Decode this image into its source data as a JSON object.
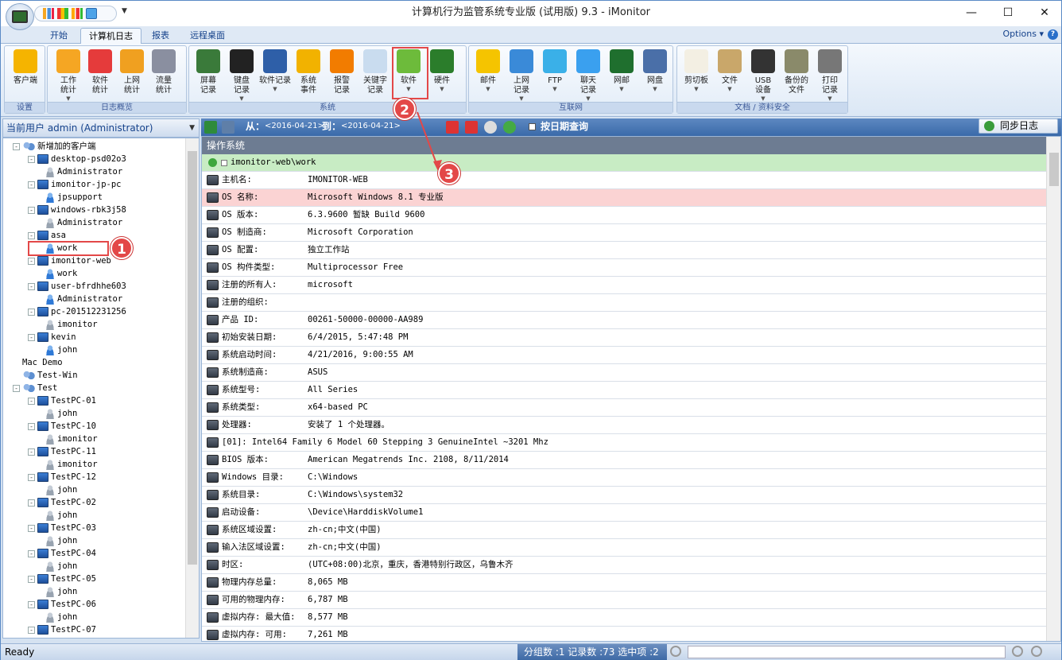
{
  "window": {
    "title": "计算机行为监管系统专业版 (试用版) 9.3 - iMonitor",
    "min_label": "—",
    "max_label": "☐",
    "close_label": "✕"
  },
  "tabs": [
    {
      "label": "开始"
    },
    {
      "label": "计算机日志"
    },
    {
      "label": "报表"
    },
    {
      "label": "远程桌面"
    }
  ],
  "options_label": "Options",
  "ribbon": {
    "groups": [
      {
        "label": "设置",
        "buttons": [
          {
            "l1": "客户端",
            "l2": "",
            "dd": false
          }
        ]
      },
      {
        "label": "日志概览",
        "buttons": [
          {
            "l1": "工作",
            "l2": "统计",
            "dd": true
          },
          {
            "l1": "软件",
            "l2": "统计",
            "dd": false
          },
          {
            "l1": "上网",
            "l2": "统计",
            "dd": false
          },
          {
            "l1": "流量",
            "l2": "统计",
            "dd": false
          }
        ]
      },
      {
        "label": "系统",
        "buttons": [
          {
            "l1": "屏幕",
            "l2": "记录",
            "dd": false
          },
          {
            "l1": "键盘",
            "l2": "记录",
            "dd": true
          },
          {
            "l1": "软件记录",
            "l2": "",
            "dd": true
          },
          {
            "l1": "系统",
            "l2": "事件",
            "dd": false
          },
          {
            "l1": "报警",
            "l2": "记录",
            "dd": false
          },
          {
            "l1": "关键字",
            "l2": "记录",
            "dd": false
          },
          {
            "l1": "软件",
            "l2": "",
            "dd": true
          },
          {
            "l1": "硬件",
            "l2": "",
            "dd": true
          }
        ]
      },
      {
        "label": "互联网",
        "buttons": [
          {
            "l1": "邮件",
            "l2": "",
            "dd": true
          },
          {
            "l1": "上网",
            "l2": "记录",
            "dd": true
          },
          {
            "l1": "FTP",
            "l2": "",
            "dd": true
          },
          {
            "l1": "聊天",
            "l2": "记录",
            "dd": true
          },
          {
            "l1": "网邮",
            "l2": "",
            "dd": true
          },
          {
            "l1": "网盘",
            "l2": "",
            "dd": true
          }
        ]
      },
      {
        "label": "文档 / 资料安全",
        "buttons": [
          {
            "l1": "剪切板",
            "l2": "",
            "dd": true
          },
          {
            "l1": "文件",
            "l2": "",
            "dd": true
          },
          {
            "l1": "USB",
            "l2": "设备",
            "dd": true
          },
          {
            "l1": "备份的",
            "l2": "文件",
            "dd": false
          },
          {
            "l1": "打印",
            "l2": "记录",
            "dd": true
          }
        ]
      }
    ]
  },
  "callouts": [
    "1",
    "2",
    "3"
  ],
  "left_panel": {
    "header": "当前用户 admin (Administrator)",
    "tree": [
      {
        "label": "新增加的客户端",
        "level": 0,
        "type": "group",
        "exp": "-"
      },
      {
        "label": "desktop-psd02o3",
        "level": 1,
        "type": "pc",
        "exp": "-"
      },
      {
        "label": "Administrator",
        "level": 2,
        "type": "user-grey"
      },
      {
        "label": "imonitor-jp-pc",
        "level": 1,
        "type": "pc",
        "exp": "-"
      },
      {
        "label": "jpsupport",
        "level": 2,
        "type": "user"
      },
      {
        "label": "windows-rbk3j58",
        "level": 1,
        "type": "pc",
        "exp": "-"
      },
      {
        "label": "Administrator",
        "level": 2,
        "type": "user-grey"
      },
      {
        "label": "asa",
        "level": 1,
        "type": "pc",
        "exp": "-"
      },
      {
        "label": "work",
        "level": 2,
        "type": "user"
      },
      {
        "label": "imonitor-web",
        "level": 1,
        "type": "pc",
        "exp": "-"
      },
      {
        "label": "work",
        "level": 2,
        "type": "user"
      },
      {
        "label": "user-bfrdhhe603",
        "level": 1,
        "type": "pc",
        "exp": "-"
      },
      {
        "label": "Administrator",
        "level": 2,
        "type": "user"
      },
      {
        "label": "pc-201512231256",
        "level": 1,
        "type": "pc",
        "exp": "-"
      },
      {
        "label": "imonitor",
        "level": 2,
        "type": "user-grey"
      },
      {
        "label": "kevin",
        "level": 1,
        "type": "pc",
        "exp": "-"
      },
      {
        "label": "john",
        "level": 2,
        "type": "user"
      },
      {
        "label": "Mac Demo",
        "level": 0,
        "type": "none"
      },
      {
        "label": "Test-Win",
        "level": 0,
        "type": "group"
      },
      {
        "label": "Test",
        "level": 0,
        "type": "group",
        "exp": "-"
      },
      {
        "label": "TestPC-01",
        "level": 1,
        "type": "pc",
        "exp": "-"
      },
      {
        "label": "john",
        "level": 2,
        "type": "user-grey"
      },
      {
        "label": "TestPC-10",
        "level": 1,
        "type": "pc",
        "exp": "-"
      },
      {
        "label": "imonitor",
        "level": 2,
        "type": "user-grey"
      },
      {
        "label": "TestPC-11",
        "level": 1,
        "type": "pc",
        "exp": "-"
      },
      {
        "label": "imonitor",
        "level": 2,
        "type": "user-grey"
      },
      {
        "label": "TestPC-12",
        "level": 1,
        "type": "pc",
        "exp": "-"
      },
      {
        "label": "john",
        "level": 2,
        "type": "user-grey"
      },
      {
        "label": "TestPC-02",
        "level": 1,
        "type": "pc",
        "exp": "-"
      },
      {
        "label": "john",
        "level": 2,
        "type": "user-grey"
      },
      {
        "label": "TestPC-03",
        "level": 1,
        "type": "pc",
        "exp": "-"
      },
      {
        "label": "john",
        "level": 2,
        "type": "user-grey"
      },
      {
        "label": "TestPC-04",
        "level": 1,
        "type": "pc",
        "exp": "-"
      },
      {
        "label": "john",
        "level": 2,
        "type": "user-grey"
      },
      {
        "label": "TestPC-05",
        "level": 1,
        "type": "pc",
        "exp": "-"
      },
      {
        "label": "john",
        "level": 2,
        "type": "user-grey"
      },
      {
        "label": "TestPC-06",
        "level": 1,
        "type": "pc",
        "exp": "-"
      },
      {
        "label": "john",
        "level": 2,
        "type": "user-grey"
      },
      {
        "label": "TestPC-07",
        "level": 1,
        "type": "pc",
        "exp": "-"
      }
    ]
  },
  "right_panel": {
    "from_label": "从：",
    "from_date": "<2016-04-21>",
    "to_label": "到：",
    "to_date": "<2016-04-21>",
    "by_date_label": "按日期查询",
    "sync_label": "同步日志",
    "grid_header": "操作系统",
    "group_row": "imonitor-web\\work",
    "rows": [
      {
        "k": "主机名:",
        "v": "IMONITOR-WEB"
      },
      {
        "k": "OS 名称:",
        "v": "Microsoft Windows 8.1 专业版",
        "hl": true
      },
      {
        "k": "OS 版本:",
        "v": "6.3.9600 暂缺 Build 9600"
      },
      {
        "k": "OS 制造商:",
        "v": "Microsoft Corporation"
      },
      {
        "k": "OS 配置:",
        "v": "独立工作站"
      },
      {
        "k": "OS 构件类型:",
        "v": "Multiprocessor Free"
      },
      {
        "k": "注册的所有人:",
        "v": "microsoft"
      },
      {
        "k": "注册的组织:",
        "v": ""
      },
      {
        "k": "产品 ID:",
        "v": "00261-50000-00000-AA989"
      },
      {
        "k": "初始安装日期:",
        "v": "6/4/2015, 5:47:48 PM"
      },
      {
        "k": "系统启动时间:",
        "v": "4/21/2016, 9:00:55 AM"
      },
      {
        "k": "系统制造商:",
        "v": "ASUS"
      },
      {
        "k": "系统型号:",
        "v": "All Series"
      },
      {
        "k": "系统类型:",
        "v": "x64-based PC"
      },
      {
        "k": "处理器:",
        "v": "安装了 1 个处理器。"
      },
      {
        "full": "[01]: Intel64 Family 6 Model 60 Stepping 3 GenuineIntel ~3201 Mhz"
      },
      {
        "k": "BIOS 版本:",
        "v": "American Megatrends Inc. 2108, 8/11/2014"
      },
      {
        "k": "Windows 目录:",
        "v": "C:\\Windows"
      },
      {
        "k": "系统目录:",
        "v": "C:\\Windows\\system32"
      },
      {
        "k": "启动设备:",
        "v": "\\Device\\HarddiskVolume1"
      },
      {
        "k": "系统区域设置:",
        "v": "zh-cn;中文(中国)"
      },
      {
        "k": "输入法区域设置:",
        "v": "zh-cn;中文(中国)"
      },
      {
        "k": "时区:",
        "v": "(UTC+08:00)北京，重庆，香港特别行政区，乌鲁木齐"
      },
      {
        "k": "物理内存总量:",
        "v": "8,065 MB"
      },
      {
        "k": "可用的物理内存:",
        "v": "6,787 MB"
      },
      {
        "k": "虚拟内存: 最大值:",
        "v": "8,577 MB"
      },
      {
        "k": "虚拟内存: 可用:",
        "v": "7,261 MB"
      }
    ]
  },
  "status": {
    "ready": "Ready",
    "counts": "分组数 :1  记录数 :73  选中项 :2"
  }
}
